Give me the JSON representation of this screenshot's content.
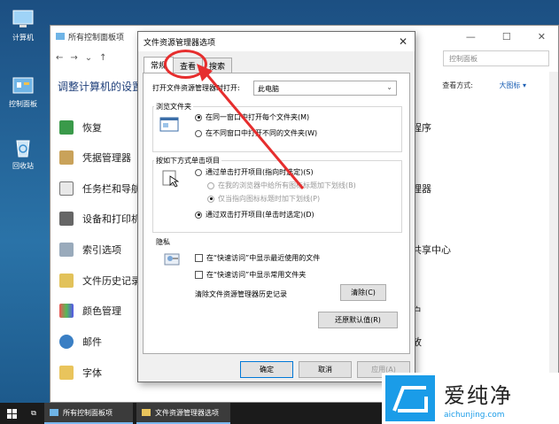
{
  "desktop": {
    "icons": [
      {
        "label": "计算机",
        "icon": "computer-icon"
      },
      {
        "label": "控制面板",
        "icon": "control-panel-icon"
      },
      {
        "label": "回收站",
        "icon": "recycle-bin-icon"
      }
    ]
  },
  "control_panel": {
    "title": "所有控制面板项",
    "search_placeholder": "控制面板",
    "heading": "调整计算机的设置",
    "view_label": "查看方式:",
    "view_value": "大图标 ▾",
    "items": [
      "恢复",
      "凭据管理器",
      "任务栏和导航",
      "设备和打印机",
      "索引选项",
      "文件历史记录",
      "颜色管理",
      "邮件",
      "字体"
    ],
    "right_items": [
      "程序",
      "理器",
      "共享中心",
      "户",
      "放"
    ]
  },
  "dialog": {
    "title": "文件资源管理器选项",
    "tabs": [
      "常规",
      "查看",
      "搜索"
    ],
    "active_tab": 0,
    "open_label": "打开文件资源管理器时打开:",
    "open_value": "此电脑",
    "browse_group": "浏览文件夹",
    "browse_same": "在同一窗口中打开每个文件夹(M)",
    "browse_new": "在不同窗口中打开不同的文件夹(W)",
    "click_group": "按如下方式单击项目",
    "click_single": "通过单击打开项目(指向时选定)(S)",
    "click_underline_browser": "在我的浏览器中给所有图标标题加下划线(B)",
    "click_underline_hover": "仅当指向图标标题时加下划线(P)",
    "click_double": "通过双击打开项目(单击时选定)(D)",
    "privacy_group": "隐私",
    "privacy_recent": "在“快速访问”中显示最近使用的文件",
    "privacy_frequent": "在“快速访问”中显示常用文件夹",
    "clear_label": "清除文件资源管理器历史记录",
    "clear_button": "清除(C)",
    "restore_button": "还原默认值(R)",
    "ok_button": "确定",
    "cancel_button": "取消",
    "apply_button": "应用(A)"
  },
  "taskbar": {
    "tasks": [
      "所有控制面板项",
      "文件资源管理器选项"
    ]
  },
  "watermark": {
    "name": "爱纯净",
    "url": "aichunjing.com"
  },
  "colors": {
    "accent": "#0078d7",
    "annotation": "#e62e2e",
    "watermark": "#1a9ce8"
  }
}
